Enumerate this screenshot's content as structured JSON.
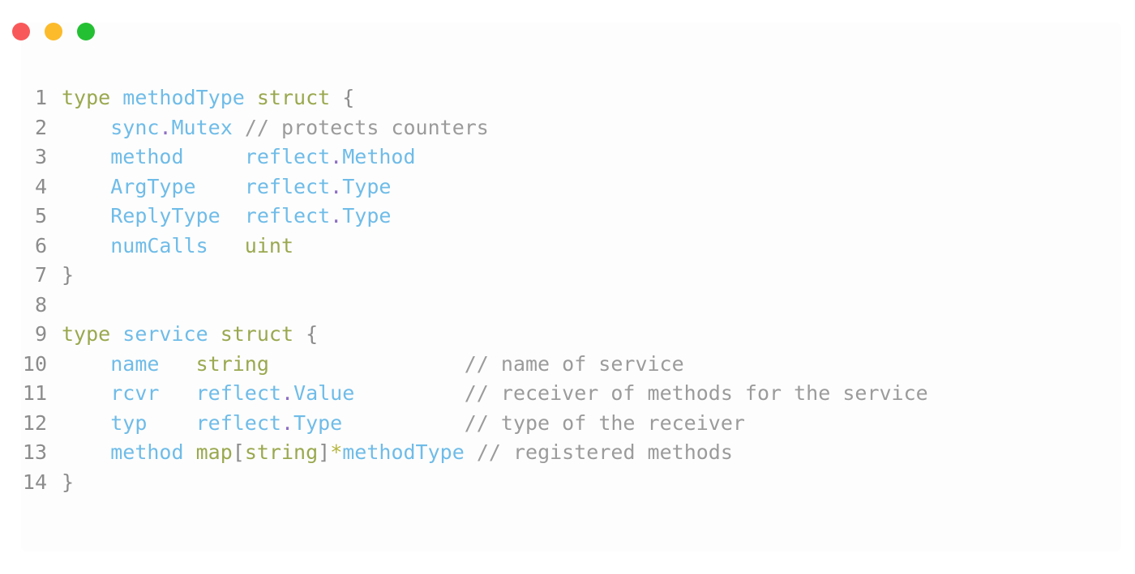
{
  "window": {
    "controls": [
      {
        "name": "close",
        "color": "#f9585a"
      },
      {
        "name": "minimize",
        "color": "#fcbb2b"
      },
      {
        "name": "maximize",
        "color": "#24c033"
      }
    ]
  },
  "editor": {
    "language": "go",
    "background": "#fdfdfd",
    "gutter_color": "#8c8c8c",
    "first_line": 1,
    "last_line": 14,
    "colors": {
      "keyword": "#9aa84f",
      "type": "#9aa84f",
      "identifier": "#6fbce8",
      "comment": "#9b9b9b",
      "punctuation": "#8c8c8c",
      "dot_operator": "#8e6fc4",
      "star_operator": "#b5b53f"
    },
    "lines": [
      {
        "number": "1",
        "text": "type methodType struct {",
        "tokens": [
          {
            "t": "type",
            "c": "tok-keyword"
          },
          {
            "t": " ",
            "c": "tok-plain"
          },
          {
            "t": "methodType",
            "c": "tok-ident"
          },
          {
            "t": " ",
            "c": "tok-plain"
          },
          {
            "t": "struct",
            "c": "tok-keyword"
          },
          {
            "t": " ",
            "c": "tok-plain"
          },
          {
            "t": "{",
            "c": "tok-punct"
          }
        ]
      },
      {
        "number": "2",
        "text": "    sync.Mutex // protects counters",
        "tokens": [
          {
            "t": "    ",
            "c": "tok-plain"
          },
          {
            "t": "sync",
            "c": "tok-ident"
          },
          {
            "t": ".",
            "c": "tok-dot"
          },
          {
            "t": "Mutex",
            "c": "tok-ident"
          },
          {
            "t": " ",
            "c": "tok-plain"
          },
          {
            "t": "// protects counters",
            "c": "tok-comment"
          }
        ]
      },
      {
        "number": "3",
        "text": "    method     reflect.Method",
        "tokens": [
          {
            "t": "    ",
            "c": "tok-plain"
          },
          {
            "t": "method",
            "c": "tok-ident"
          },
          {
            "t": "     ",
            "c": "tok-plain"
          },
          {
            "t": "reflect",
            "c": "tok-ident"
          },
          {
            "t": ".",
            "c": "tok-dot"
          },
          {
            "t": "Method",
            "c": "tok-ident"
          }
        ]
      },
      {
        "number": "4",
        "text": "    ArgType    reflect.Type",
        "tokens": [
          {
            "t": "    ",
            "c": "tok-plain"
          },
          {
            "t": "ArgType",
            "c": "tok-ident"
          },
          {
            "t": "    ",
            "c": "tok-plain"
          },
          {
            "t": "reflect",
            "c": "tok-ident"
          },
          {
            "t": ".",
            "c": "tok-dot"
          },
          {
            "t": "Type",
            "c": "tok-ident"
          }
        ]
      },
      {
        "number": "5",
        "text": "    ReplyType  reflect.Type",
        "tokens": [
          {
            "t": "    ",
            "c": "tok-plain"
          },
          {
            "t": "ReplyType",
            "c": "tok-ident"
          },
          {
            "t": "  ",
            "c": "tok-plain"
          },
          {
            "t": "reflect",
            "c": "tok-ident"
          },
          {
            "t": ".",
            "c": "tok-dot"
          },
          {
            "t": "Type",
            "c": "tok-ident"
          }
        ]
      },
      {
        "number": "6",
        "text": "    numCalls   uint",
        "tokens": [
          {
            "t": "    ",
            "c": "tok-plain"
          },
          {
            "t": "numCalls",
            "c": "tok-ident"
          },
          {
            "t": "   ",
            "c": "tok-plain"
          },
          {
            "t": "uint",
            "c": "tok-type"
          }
        ]
      },
      {
        "number": "7",
        "text": "}",
        "tokens": [
          {
            "t": "}",
            "c": "tok-punct"
          }
        ]
      },
      {
        "number": "8",
        "text": "",
        "tokens": []
      },
      {
        "number": "9",
        "text": "type service struct {",
        "tokens": [
          {
            "t": "type",
            "c": "tok-keyword"
          },
          {
            "t": " ",
            "c": "tok-plain"
          },
          {
            "t": "service",
            "c": "tok-ident"
          },
          {
            "t": " ",
            "c": "tok-plain"
          },
          {
            "t": "struct",
            "c": "tok-keyword"
          },
          {
            "t": " ",
            "c": "tok-plain"
          },
          {
            "t": "{",
            "c": "tok-punct"
          }
        ]
      },
      {
        "number": "10",
        "text": "    name   string                // name of service",
        "tokens": [
          {
            "t": "    ",
            "c": "tok-plain"
          },
          {
            "t": "name",
            "c": "tok-ident"
          },
          {
            "t": "   ",
            "c": "tok-plain"
          },
          {
            "t": "string",
            "c": "tok-type"
          },
          {
            "t": "                ",
            "c": "tok-plain"
          },
          {
            "t": "// name of service",
            "c": "tok-comment"
          }
        ]
      },
      {
        "number": "11",
        "text": "    rcvr   reflect.Value         // receiver of methods for the service",
        "tokens": [
          {
            "t": "    ",
            "c": "tok-plain"
          },
          {
            "t": "rcvr",
            "c": "tok-ident"
          },
          {
            "t": "   ",
            "c": "tok-plain"
          },
          {
            "t": "reflect",
            "c": "tok-ident"
          },
          {
            "t": ".",
            "c": "tok-dot"
          },
          {
            "t": "Value",
            "c": "tok-ident"
          },
          {
            "t": "         ",
            "c": "tok-plain"
          },
          {
            "t": "// receiver of methods for the service",
            "c": "tok-comment"
          }
        ]
      },
      {
        "number": "12",
        "text": "    typ    reflect.Type          // type of the receiver",
        "tokens": [
          {
            "t": "    ",
            "c": "tok-plain"
          },
          {
            "t": "typ",
            "c": "tok-ident"
          },
          {
            "t": "    ",
            "c": "tok-plain"
          },
          {
            "t": "reflect",
            "c": "tok-ident"
          },
          {
            "t": ".",
            "c": "tok-dot"
          },
          {
            "t": "Type",
            "c": "tok-ident"
          },
          {
            "t": "          ",
            "c": "tok-plain"
          },
          {
            "t": "// type of the receiver",
            "c": "tok-comment"
          }
        ]
      },
      {
        "number": "13",
        "text": "    method map[string]*methodType // registered methods",
        "tokens": [
          {
            "t": "    ",
            "c": "tok-plain"
          },
          {
            "t": "method",
            "c": "tok-ident"
          },
          {
            "t": " ",
            "c": "tok-plain"
          },
          {
            "t": "map",
            "c": "tok-type"
          },
          {
            "t": "[",
            "c": "tok-punct"
          },
          {
            "t": "string",
            "c": "tok-type"
          },
          {
            "t": "]",
            "c": "tok-punct"
          },
          {
            "t": "*",
            "c": "tok-op"
          },
          {
            "t": "methodType",
            "c": "tok-ident"
          },
          {
            "t": " ",
            "c": "tok-plain"
          },
          {
            "t": "// registered methods",
            "c": "tok-comment"
          }
        ]
      },
      {
        "number": "14",
        "text": "}",
        "tokens": [
          {
            "t": "}",
            "c": "tok-punct"
          }
        ]
      }
    ]
  }
}
